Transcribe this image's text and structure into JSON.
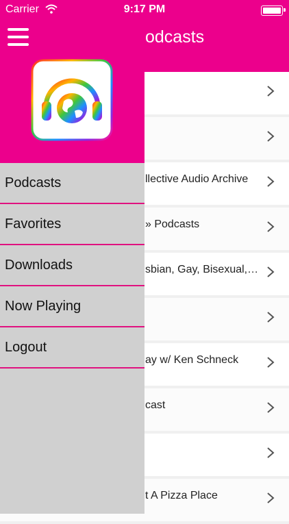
{
  "status_bar": {
    "carrier": "Carrier",
    "time": "9:17 PM"
  },
  "nav": {
    "title": "odcasts"
  },
  "list": {
    "rows": [
      {
        "label": ""
      },
      {
        "label": ""
      },
      {
        "label": "llective Audio Archive"
      },
      {
        "label": "» Podcasts"
      },
      {
        "label": "sbian, Gay, Bisexual,…"
      },
      {
        "label": ""
      },
      {
        "label": "ay w/ Ken Schneck"
      },
      {
        "label": "cast"
      },
      {
        "label": ""
      },
      {
        "label": "t A Pizza Place"
      }
    ]
  },
  "drawer": {
    "items": [
      {
        "label": "Podcasts"
      },
      {
        "label": "Favorites"
      },
      {
        "label": "Downloads"
      },
      {
        "label": "Now Playing"
      },
      {
        "label": "Logout"
      }
    ]
  },
  "colors": {
    "accent": "#ec008c",
    "drawer_bg": "#d0d0d0"
  },
  "icons": [
    "menu-icon",
    "app-logo",
    "wifi-icon",
    "battery-icon",
    "chevron-right-icon"
  ]
}
